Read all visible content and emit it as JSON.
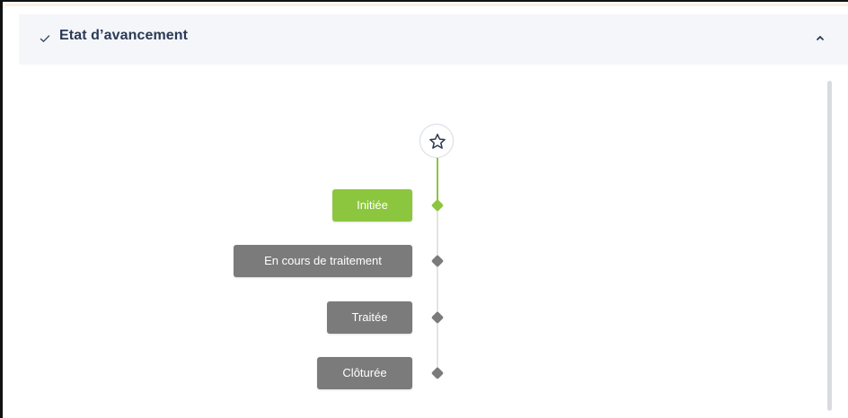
{
  "panel": {
    "title": "Etat d’avancement",
    "check_icon": "check-icon",
    "collapse_icon": "chevron-up-icon"
  },
  "timeline": {
    "start_icon": "star-outline-icon",
    "steps": [
      {
        "label": "Initiée",
        "state": "current",
        "color": "#8cc63f"
      },
      {
        "label": "En cours de traitement",
        "state": "pending",
        "color": "#7b7b7b"
      },
      {
        "label": "Traitée",
        "state": "pending",
        "color": "#7b7b7b"
      },
      {
        "label": "Clôturée",
        "state": "pending",
        "color": "#7b7b7b"
      }
    ],
    "completed_color": "#8cc63f",
    "pending_line_color": "#e4e4e4",
    "pending_dot_color": "#7b7b7b"
  }
}
